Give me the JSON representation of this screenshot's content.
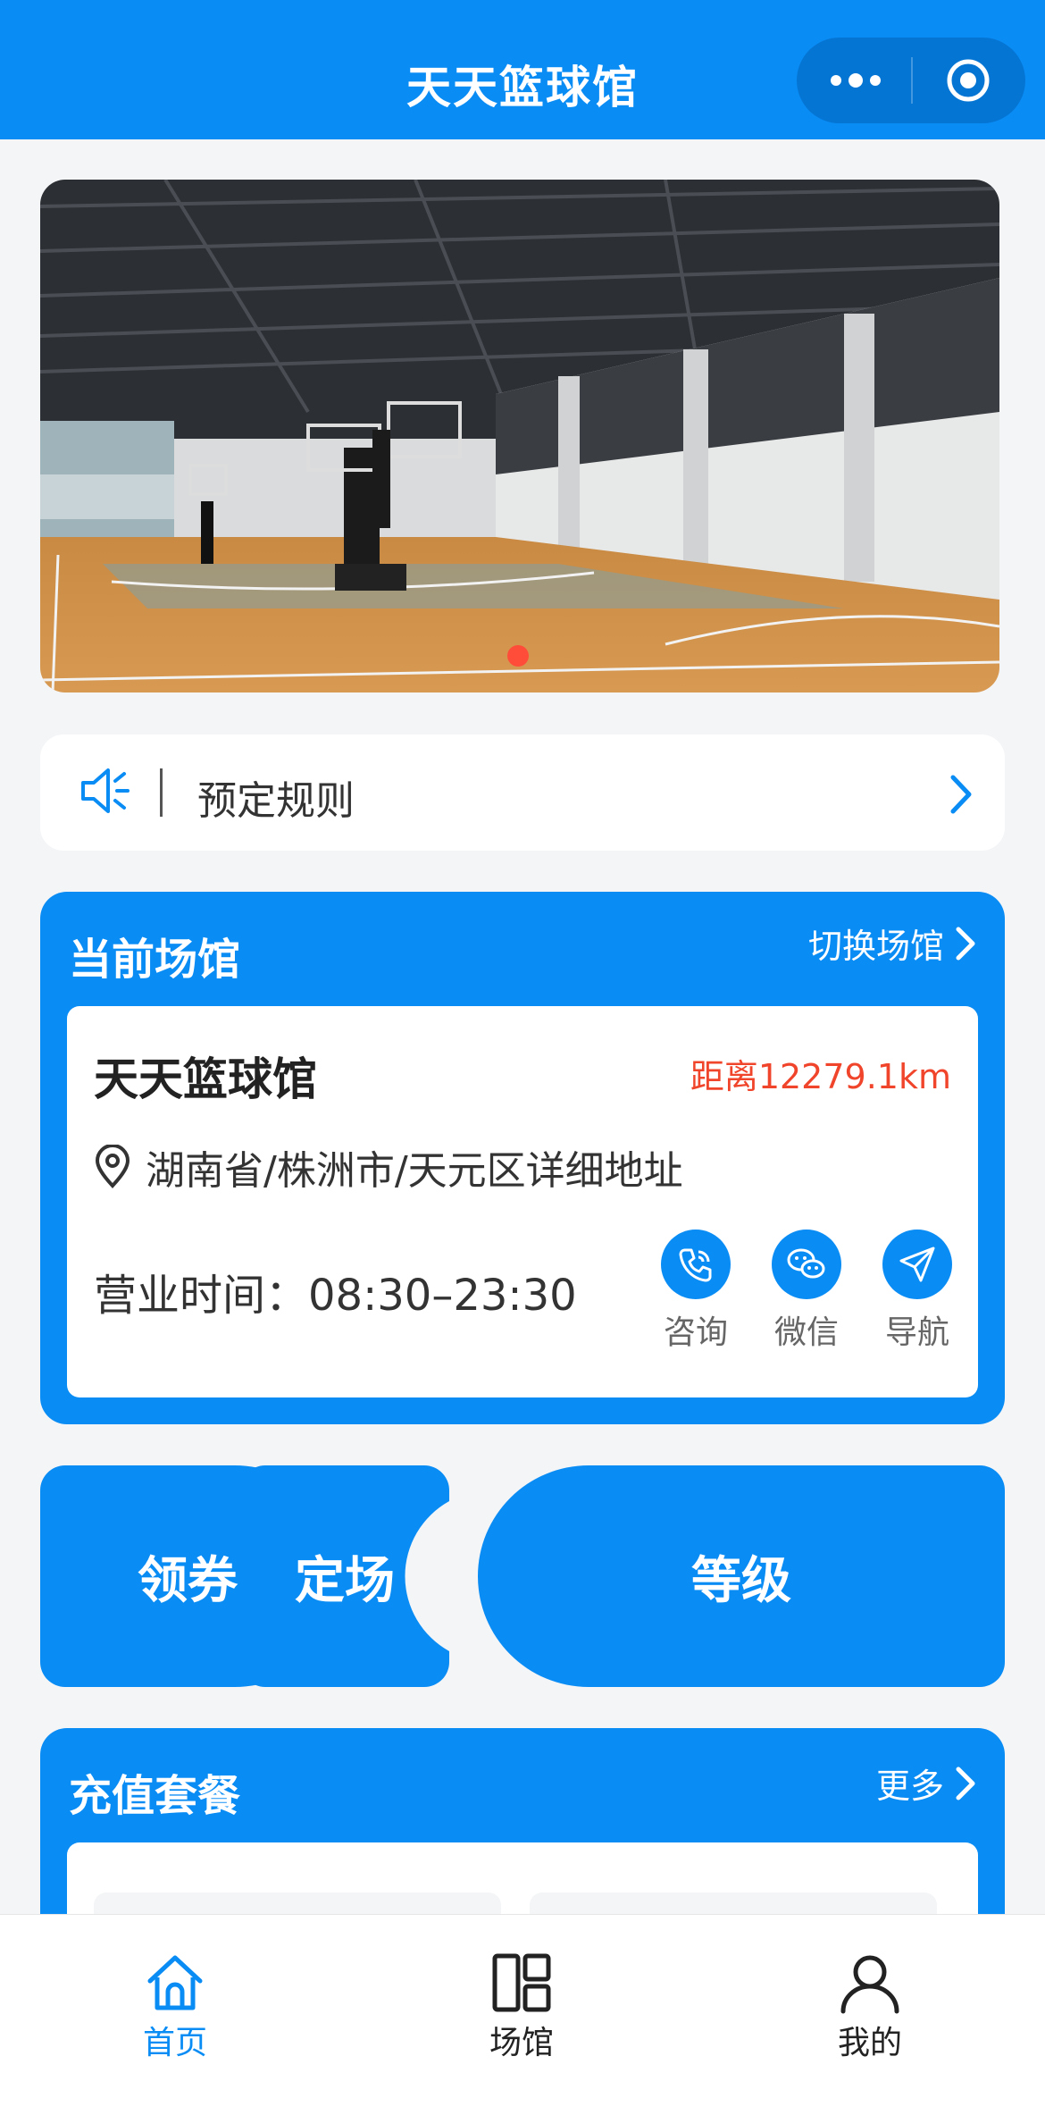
{
  "header": {
    "title": "天天篮球馆"
  },
  "notice": {
    "label": "预定规则"
  },
  "current_venue": {
    "section_title": "当前场馆",
    "switch_label": "切换场馆",
    "name": "天天篮球馆",
    "distance": "距离12279.1km",
    "address": "湖南省/株洲市/天元区详细地址",
    "hours": "营业时间：08:30–23:30",
    "actions": [
      {
        "label": "咨询",
        "icon": "phone-icon"
      },
      {
        "label": "微信",
        "icon": "wechat-icon"
      },
      {
        "label": "导航",
        "icon": "navigation-icon"
      }
    ]
  },
  "big_buttons": {
    "coupon": "领券",
    "book": "定场",
    "level": "等级"
  },
  "recharge": {
    "section_title": "充值套餐",
    "more_label": "更多"
  },
  "tabbar": {
    "items": [
      {
        "label": "首页",
        "icon": "home-icon",
        "active": true
      },
      {
        "label": "场馆",
        "icon": "venue-grid-icon",
        "active": false
      },
      {
        "label": "我的",
        "icon": "user-icon",
        "active": false
      }
    ]
  },
  "colors": {
    "primary": "#0a8cf5",
    "distance": "#f0442b",
    "indicator": "#ff4d3a"
  }
}
